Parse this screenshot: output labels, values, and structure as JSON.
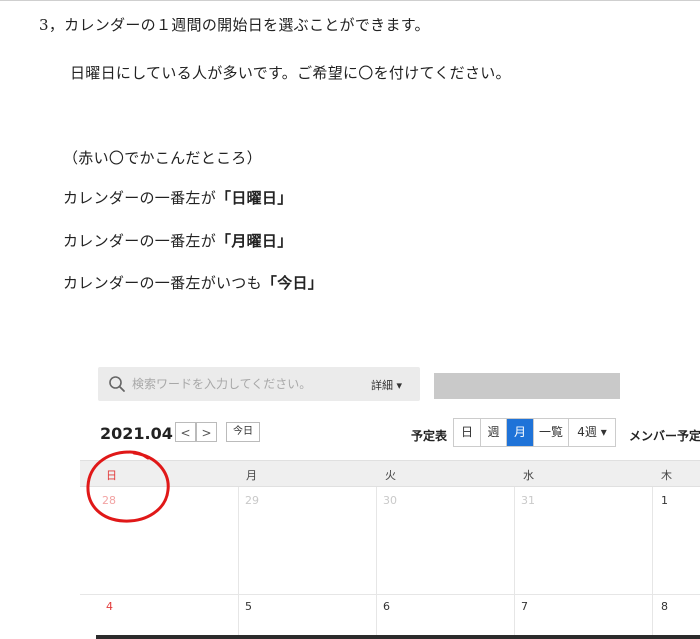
{
  "document": {
    "heading": "3，カレンダーの１週間の開始日を選ぶことができます。",
    "subline": "日曜日にしている人が多いです。ご希望に〇を付けてください。",
    "note": "（赤い〇でかこんだところ）",
    "options": [
      {
        "prefix": "カレンダーの一番左が",
        "value": "「日曜日」"
      },
      {
        "prefix": "カレンダーの一番左が",
        "value": "「月曜日」"
      },
      {
        "prefix": "カレンダーの一番左がいつも",
        "value": "「今日」"
      }
    ]
  },
  "calendar": {
    "search_placeholder": "検索ワードを入力してください。",
    "detail_label": "詳細 ▾",
    "date_label": "2021.04",
    "prev": "<",
    "next": ">",
    "today": "今日",
    "schedule_label": "予定表",
    "views": [
      "日",
      "週",
      "月",
      "一覧",
      "4週 ▾"
    ],
    "active_view": "月",
    "member_label": "メンバー予定",
    "weekdays": [
      "日",
      "月",
      "火",
      "水",
      "木"
    ],
    "week1_days": [
      "28",
      "29",
      "30",
      "31",
      "1"
    ],
    "week2_days": [
      "4",
      "5",
      "6",
      "7",
      "8"
    ],
    "colors": {
      "accent": "#1f73d8",
      "sunday": "#e23a3a",
      "circle": "#e01818"
    }
  }
}
